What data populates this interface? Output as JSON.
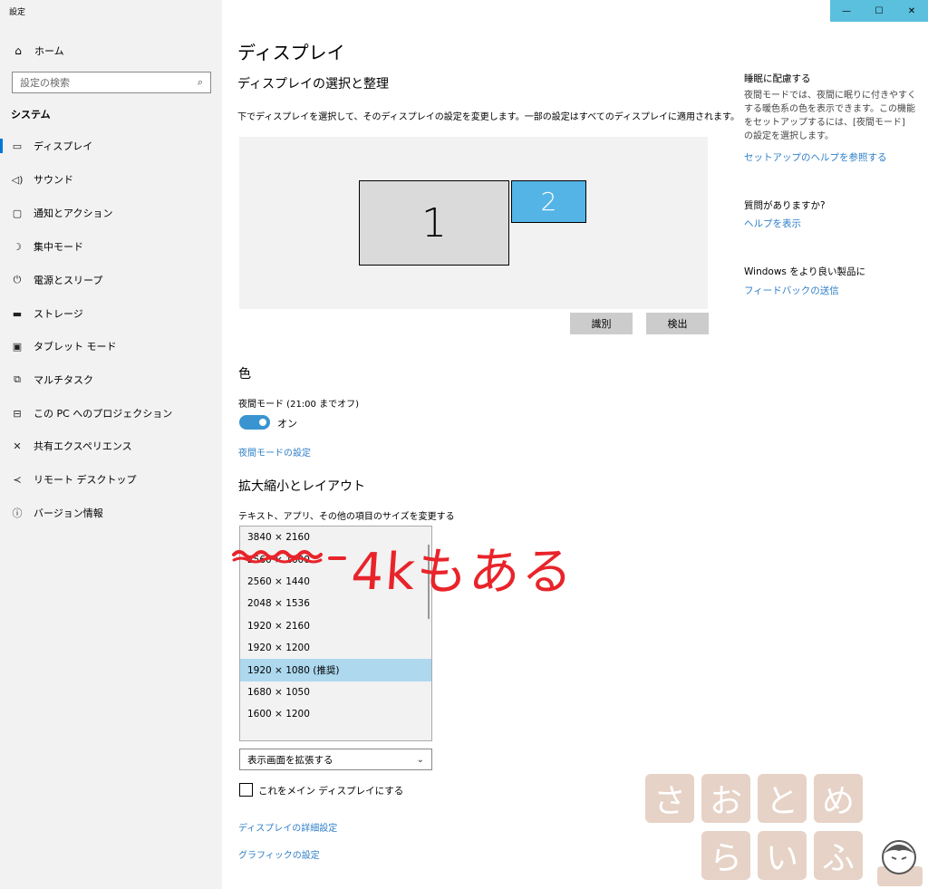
{
  "app": {
    "title": "設定"
  },
  "window_controls": {
    "minimize": "—",
    "maximize": "☐",
    "close": "✕"
  },
  "sidebar": {
    "home": {
      "label": "ホーム",
      "icon": "home-icon"
    },
    "search": {
      "placeholder": "設定の検索",
      "icon": "search-icon"
    },
    "section": "システム",
    "items": [
      {
        "label": "ディスプレイ",
        "icon": "monitor-icon",
        "active": true
      },
      {
        "label": "サウンド",
        "icon": "speaker-icon"
      },
      {
        "label": "通知とアクション",
        "icon": "notification-icon"
      },
      {
        "label": "集中モード",
        "icon": "moon-icon"
      },
      {
        "label": "電源とスリープ",
        "icon": "power-icon"
      },
      {
        "label": "ストレージ",
        "icon": "storage-icon"
      },
      {
        "label": "タブレット モード",
        "icon": "tablet-icon"
      },
      {
        "label": "マルチタスク",
        "icon": "multitask-icon"
      },
      {
        "label": "この PC へのプロジェクション",
        "icon": "projection-icon"
      },
      {
        "label": "共有エクスペリエンス",
        "icon": "share-icon"
      },
      {
        "label": "リモート デスクトップ",
        "icon": "remote-icon"
      },
      {
        "label": "バージョン情報",
        "icon": "info-icon"
      }
    ]
  },
  "main": {
    "title": "ディスプレイ",
    "arrange": {
      "title": "ディスプレイの選択と整理",
      "description": "下でディスプレイを選択して、そのディスプレイの設定を変更します。一部の設定はすべてのディスプレイに適用されます。",
      "monitor1": "1",
      "monitor2": "2",
      "identify_button": "識別",
      "detect_button": "検出"
    },
    "color": {
      "title": "色",
      "night_light_label": "夜間モード (21:00 までオフ)",
      "toggle_state": "オン",
      "night_light_link": "夜間モードの設定"
    },
    "scale": {
      "title": "拡大縮小とレイアウト",
      "description": "テキスト、アプリ、その他の項目のサイズを変更する",
      "resolutions": [
        "3840 × 2160",
        "2560 × 1600",
        "2560 × 1440",
        "2048 × 1536",
        "1920 × 2160",
        "1920 × 1200",
        "1920 × 1080 (推奨)",
        "1680 × 1050",
        "1600 × 1200"
      ],
      "selected_resolution": "1920 × 1080 (推奨)"
    },
    "multiple_displays": {
      "selected": "表示画面を拡張する",
      "main_display_checkbox": "これをメイン ディスプレイにする",
      "main_display_checked": false
    },
    "advanced_link": "ディスプレイの詳細設定",
    "graphics_link": "グラフィックの設定"
  },
  "right_panel": {
    "sleep_title": "睡眠に配慮する",
    "sleep_text": "夜間モードでは、夜間に眠りに付きやすくする暖色系の色を表示できます。この機能をセットアップするには、[夜間モード] の設定を選択します。",
    "setup_help_link": "セットアップのヘルプを参照する",
    "question_title": "質問がありますか?",
    "help_link": "ヘルプを表示",
    "windows_title": "Windows をより良い製品に",
    "feedback_link": "フィードバックの送信"
  },
  "annotation": {
    "text": "4kもある",
    "color": "#e8242a"
  },
  "watermark": {
    "line1": [
      "さ",
      "お",
      "と",
      "め"
    ],
    "line2": [
      "ら",
      "い",
      "ふ"
    ]
  },
  "colors": {
    "accent": "#0078d7",
    "link": "#2f7fc8",
    "selected_row": "#add8ee",
    "monitor2": "#55b4e6"
  }
}
